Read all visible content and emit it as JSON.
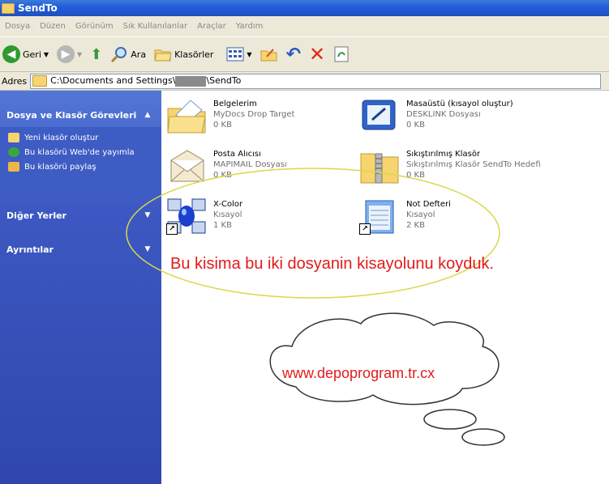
{
  "window": {
    "title": "SendTo"
  },
  "menu": [
    "Dosya",
    "Düzen",
    "Görünüm",
    "Sık Kullanılanlar",
    "Araçlar",
    "Yardım"
  ],
  "toolbar": {
    "back_label": "Geri",
    "search_label": "Ara",
    "folders_label": "Klasörler"
  },
  "address": {
    "label": "Adres",
    "path_start": "C:\\Documents and Settings\\",
    "path_end": "\\SendTo"
  },
  "sidebar": {
    "tasks_title": "Dosya ve Klasör Görevleri",
    "tasks": [
      {
        "label": "Yeni klasör oluştur"
      },
      {
        "label": "Bu klasörü Web'de yayımla"
      },
      {
        "label": "Bu klasörü paylaş"
      }
    ],
    "other_places": "Diğer Yerler",
    "details": "Ayrıntılar"
  },
  "files": [
    {
      "name": "Belgelerim",
      "type": "MyDocs Drop Target",
      "size": "0 KB"
    },
    {
      "name": "Masaüstü (kısayol oluştur)",
      "type": "DESKLINK Dosyası",
      "size": "0 KB"
    },
    {
      "name": "Posta Alıcısı",
      "type": "MAPIMAIL Dosyası",
      "size": "0 KB"
    },
    {
      "name": "Sıkıştırılmış Klasör",
      "type": "Sıkıştırılmış Klasör SendTo Hedefi",
      "size": "0 KB"
    },
    {
      "name": "X-Color",
      "type": "Kısayol",
      "size": "1 KB"
    },
    {
      "name": "Not Defteri",
      "type": "Kısayol",
      "size": "2 KB"
    }
  ],
  "annotation": {
    "text": "Bu kisima bu iki dosyanin kisayolunu koyduk.",
    "url": "www.depoprogram.tr.cx"
  }
}
